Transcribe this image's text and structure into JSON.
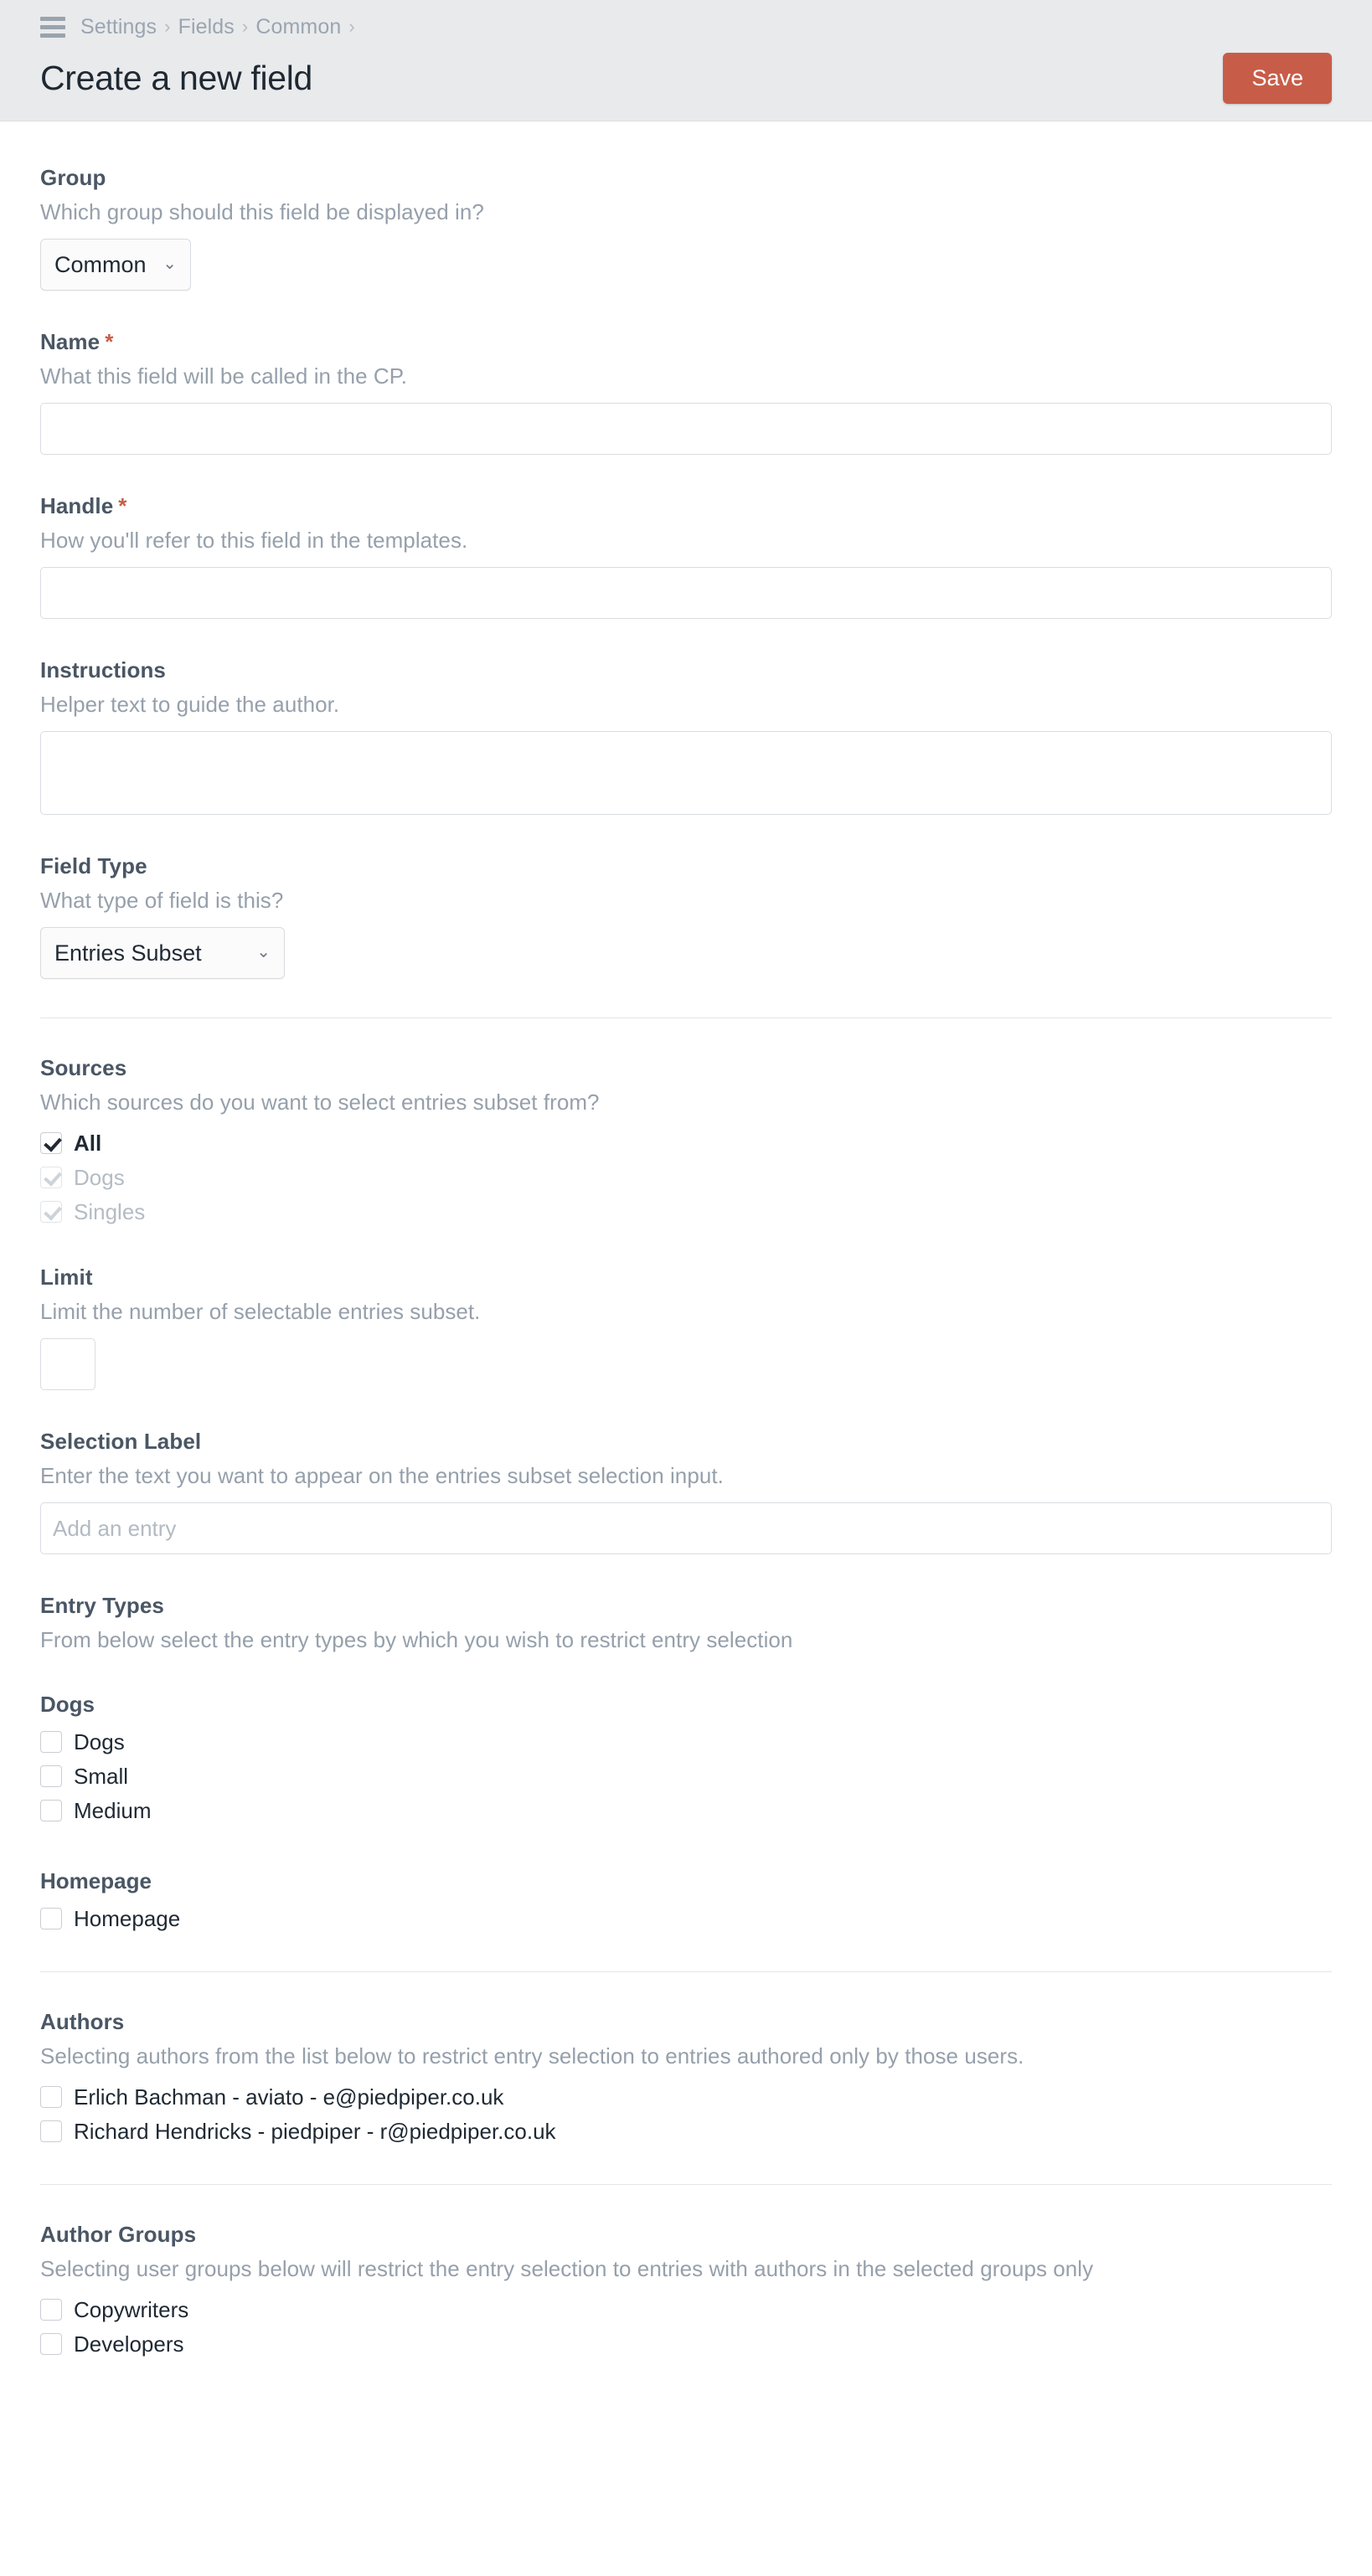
{
  "header": {
    "menu_icon": "hamburger-icon",
    "breadcrumbs": [
      "Settings",
      "Fields",
      "Common"
    ],
    "separator": "›",
    "title": "Create a new field",
    "save_label": "Save",
    "save_color": "#c75d48",
    "background": "#e9eaec"
  },
  "form": {
    "group": {
      "label": "Group",
      "instructions": "Which group should this field be displayed in?",
      "value": "Common"
    },
    "name": {
      "label": "Name",
      "required_marker": "*",
      "instructions": "What this field will be called in the CP.",
      "value": "",
      "placeholder": ""
    },
    "handle": {
      "label": "Handle",
      "required_marker": "*",
      "instructions": "How you'll refer to this field in the templates.",
      "value": "",
      "placeholder": ""
    },
    "field_instructions": {
      "label": "Instructions",
      "instructions": "Helper text to guide the author.",
      "value": "",
      "placeholder": ""
    },
    "field_type": {
      "label": "Field Type",
      "instructions": "What type of field is this?",
      "value": "Entries Subset"
    },
    "sources": {
      "label": "Sources",
      "instructions": "Which sources do you want to select entries subset from?",
      "options": [
        {
          "label": "All",
          "checked": true,
          "disabled": false
        },
        {
          "label": "Dogs",
          "checked": true,
          "disabled": true
        },
        {
          "label": "Singles",
          "checked": true,
          "disabled": true
        }
      ]
    },
    "limit": {
      "label": "Limit",
      "instructions": "Limit the number of selectable entries subset.",
      "value": "",
      "placeholder": ""
    },
    "selection_label": {
      "label": "Selection Label",
      "instructions": "Enter the text you want to appear on the entries subset selection input.",
      "value": "",
      "placeholder": "Add an entry"
    },
    "entry_types": {
      "label": "Entry Types",
      "instructions": "From below select the entry types by which you wish to restrict entry selection",
      "groups": [
        {
          "name": "Dogs",
          "options": [
            {
              "label": "Dogs",
              "checked": false
            },
            {
              "label": "Small",
              "checked": false
            },
            {
              "label": "Medium",
              "checked": false
            }
          ]
        },
        {
          "name": "Homepage",
          "options": [
            {
              "label": "Homepage",
              "checked": false
            }
          ]
        }
      ]
    },
    "authors": {
      "label": "Authors",
      "instructions": "Selecting authors from the list below to restrict entry selection to entries authored only by those users.",
      "options": [
        {
          "label": "Erlich Bachman - aviato - e@piedpiper.co.uk",
          "checked": false
        },
        {
          "label": "Richard Hendricks - piedpiper - r@piedpiper.co.uk",
          "checked": false
        }
      ]
    },
    "author_groups": {
      "label": "Author Groups",
      "instructions": "Selecting user groups below will restrict the entry selection to entries with authors in the selected groups only",
      "options": [
        {
          "label": "Copywriters",
          "checked": false
        },
        {
          "label": "Developers",
          "checked": false
        }
      ]
    }
  },
  "icons": {
    "chevron_down": "⌄"
  }
}
